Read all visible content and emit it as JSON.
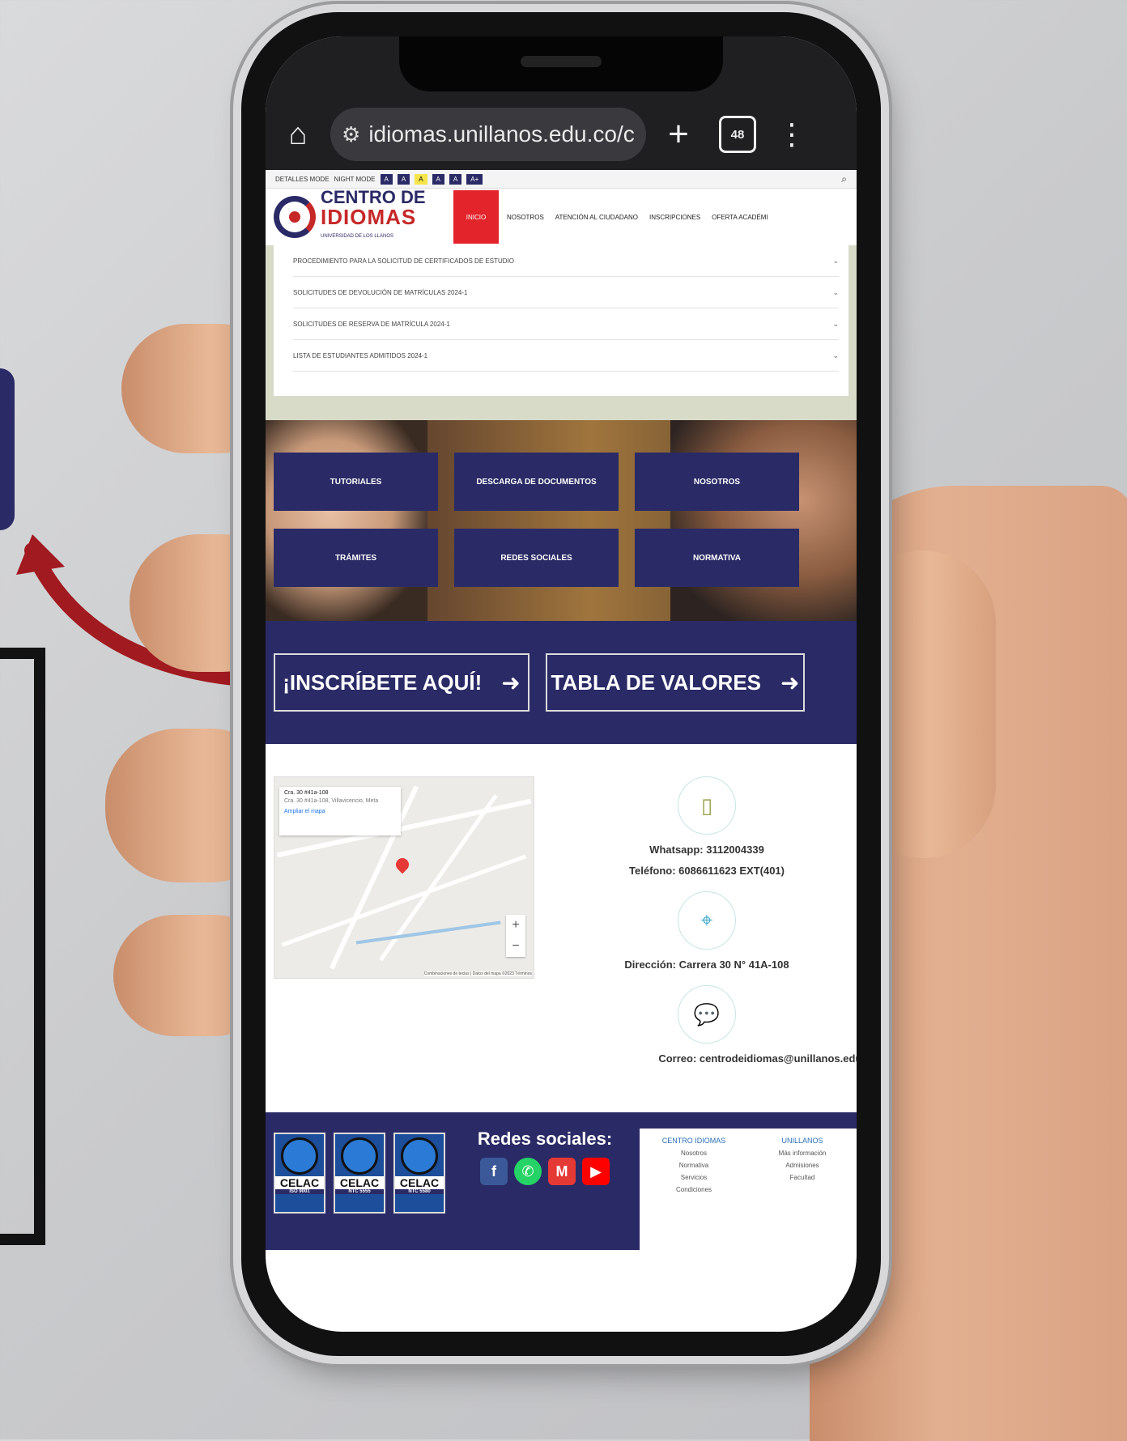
{
  "browser": {
    "url": "idiomas.unillanos.edu.co/c",
    "tab_count": "48"
  },
  "accessibility_bar": {
    "items": [
      "DETALLES MODE",
      "NIGHT MODE",
      "A",
      "A",
      "A",
      "A+"
    ]
  },
  "header": {
    "logo_line1": "CENTRO DE",
    "logo_line2": "IDIOMAS",
    "logo_line3": "UNIVERSIDAD DE LOS LLANOS",
    "nav_inicio": "INICIO",
    "nav": [
      {
        "label": "NOSOTROS"
      },
      {
        "label": "ATENCIÓN AL CIUDADANO"
      },
      {
        "label": "INSCRIPCIONES"
      },
      {
        "label": "OFERTA ACADÉMI"
      }
    ]
  },
  "accordion": [
    "PROCEDIMIENTO PARA LA SOLICITUD DE CERTIFICADOS DE ESTUDIO",
    "SOLICITUDES DE DEVOLUCIÓN DE MATRÍCULAS 2024-1",
    "SOLICITUDES DE RESERVA DE MATRÍCULA 2024-1",
    "LISTA DE ESTUDIANTES ADMITIDOS 2024-1"
  ],
  "tiles": [
    "TUTORIALES",
    "DESCARGA DE DOCUMENTOS",
    "NOSOTROS",
    "TRÁMITES",
    "REDES SOCIALES",
    "NORMATIVA"
  ],
  "cta": {
    "inscribete": "¡INSCRÍBETE AQUÍ!",
    "tabla": "TABLA DE VALORES",
    "arrow": "➜"
  },
  "map": {
    "place": "Cra. 30 #41a-108",
    "address": "Cra. 30 #41a-108, Villavicencio, Meta",
    "link": "Ampliar el mapa",
    "attribution": "Combinaciones de teclas | Datos del mapa ©2023 Términos"
  },
  "contact": {
    "whatsapp": "Whatsapp: 3112004339",
    "telefono": "Teléfono: 6086611623 EXT(401)",
    "direccion": "Dirección: Carrera 30 N° 41A-108",
    "correo": "Correo: centrodeidiomas@unillanos.edu."
  },
  "footer": {
    "badges": [
      {
        "label": "CELAC",
        "code": "ISO 9001"
      },
      {
        "label": "CELAC",
        "code": "NTC 5555"
      },
      {
        "label": "CELAC",
        "code": "NTC 5580"
      }
    ],
    "redes_title": "Redes sociales:",
    "social": [
      {
        "name": "facebook",
        "glyph": "f",
        "color": "#3b5998"
      },
      {
        "name": "whatsapp",
        "glyph": "✆",
        "color": "#25d366"
      },
      {
        "name": "gmail",
        "glyph": "M",
        "color": "#e53935"
      },
      {
        "name": "youtube",
        "glyph": "▶",
        "color": "#ff0000"
      }
    ],
    "links_col1_title": "CENTRO IDIOMAS",
    "links_col1": [
      "Nosotros",
      "Normativa",
      "Servicios",
      "Condiciones"
    ],
    "links_col2_title": "UNILLANOS",
    "links_col2": [
      "Más información",
      "Admisiones",
      "Facultad"
    ]
  },
  "colors": {
    "brand_navy": "#2a2a66",
    "brand_red": "#c62828"
  }
}
